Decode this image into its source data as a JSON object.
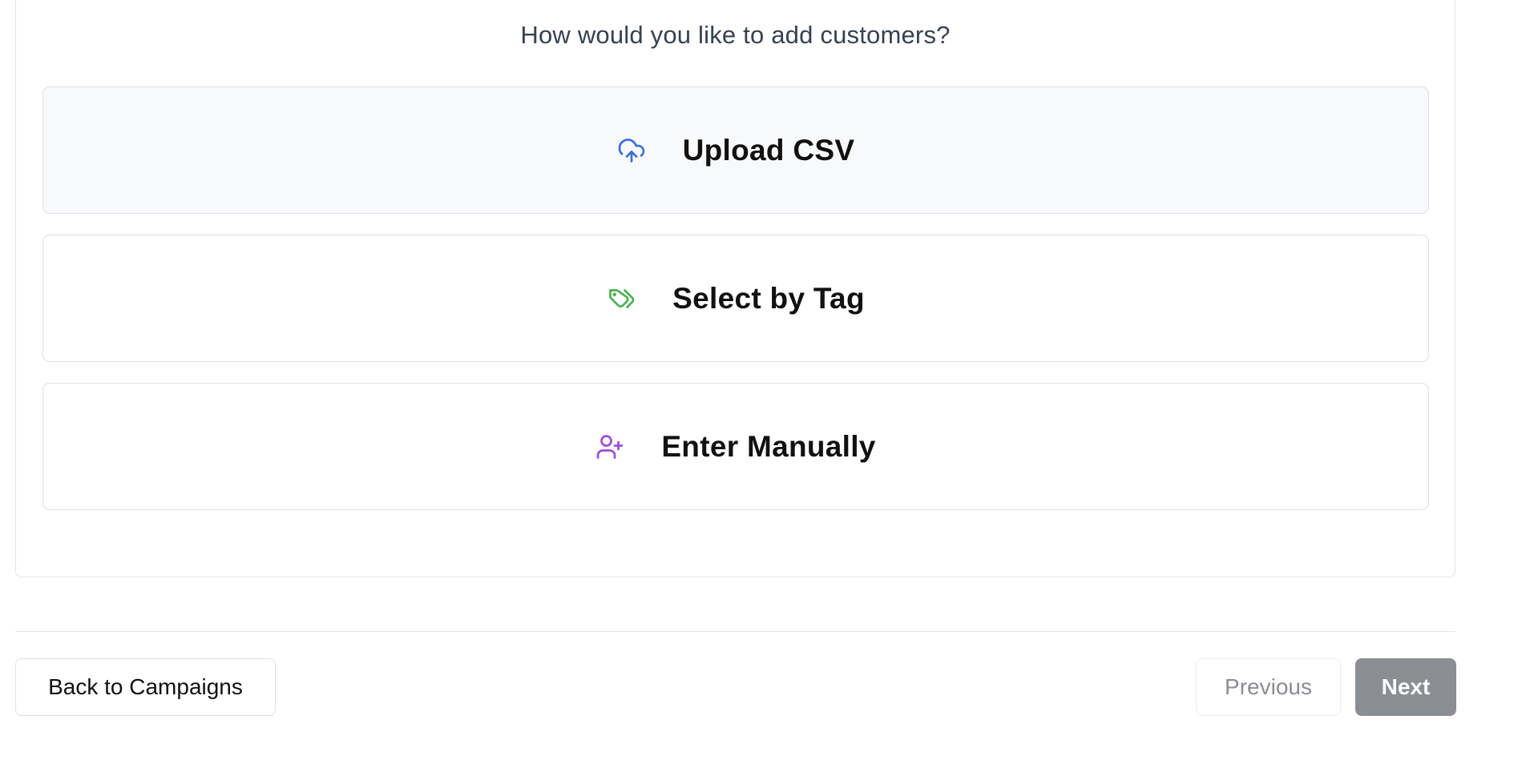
{
  "prompt": {
    "question": "How would you like to add customers?"
  },
  "options": [
    {
      "label": "Upload CSV",
      "icon": "cloud-upload-icon",
      "icon_color": "#3b6fd6",
      "selected": true
    },
    {
      "label": "Select by Tag",
      "icon": "tags-icon",
      "icon_color": "#4caf50",
      "selected": false
    },
    {
      "label": "Enter Manually",
      "icon": "user-plus-icon",
      "icon_color": "#9b4fd9",
      "selected": false
    }
  ],
  "footer": {
    "back_label": "Back to Campaigns",
    "previous_label": "Previous",
    "next_label": "Next"
  }
}
